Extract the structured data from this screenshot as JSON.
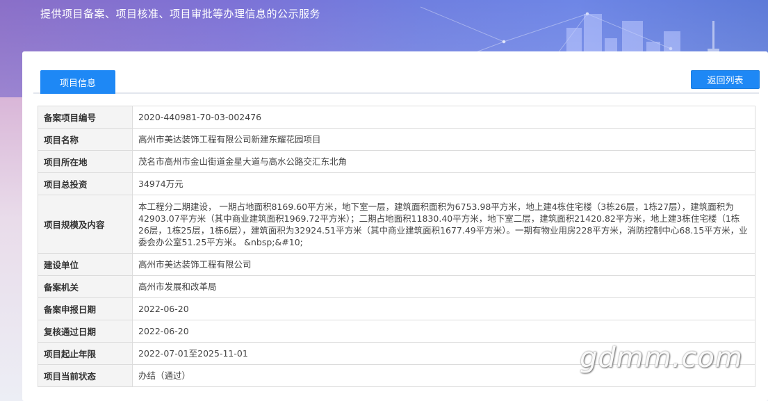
{
  "header": {
    "title": "提供项目备案、项目核准、项目审批等办理信息的公示服务"
  },
  "tabs": [
    {
      "label": "项目信息",
      "active": true
    }
  ],
  "actions": {
    "back_label": "返回列表"
  },
  "rows": [
    {
      "label": "备案项目编号",
      "value": "2020-440981-70-03-002476"
    },
    {
      "label": "项目名称",
      "value": "高州市美达装饰工程有限公司新建东耀花园项目"
    },
    {
      "label": "项目所在地",
      "value": "茂名市高州市金山街道金星大道与高水公路交汇东北角"
    },
    {
      "label": "项目总投资",
      "value": "34974万元"
    },
    {
      "label": "项目规模及内容",
      "value": "本工程分二期建设， 一期占地面积8169.60平方米，地下室一层，建筑面积面积为6753.98平方米，地上建4栋住宅楼（3栋26层，1栋27层），建筑面积为42903.07平方米（其中商业建筑面积1969.72平方米）；二期占地面积11830.40平方米，地下室二层，建筑面积21420.82平方米，地上建3栋住宅楼（1栋26层，1栋25层，1栋6层），建筑面积为32924.51平方米（其中商业建筑面积1677.49平方米）。一期有物业用房228平方米，消防控制中心68.15平方米，业委会办公室51.25平方米。          &nbsp;&#10;"
    },
    {
      "label": "建设单位",
      "value": "高州市美达装饰工程有限公司"
    },
    {
      "label": "备案机关",
      "value": "高州市发展和改革局"
    },
    {
      "label": "备案申报日期",
      "value": "2022-06-20"
    },
    {
      "label": "复核通过日期",
      "value": "2022-06-20"
    },
    {
      "label": "项目起止年限",
      "value": "2022-07-01至2025-11-01"
    },
    {
      "label": "项目当前状态",
      "value": "办结（通过）"
    }
  ],
  "watermark": "gdmm.com",
  "colors": {
    "accent": "#1e88f5",
    "label_bg": "#f4f4f4",
    "border": "#dcdcdc"
  }
}
